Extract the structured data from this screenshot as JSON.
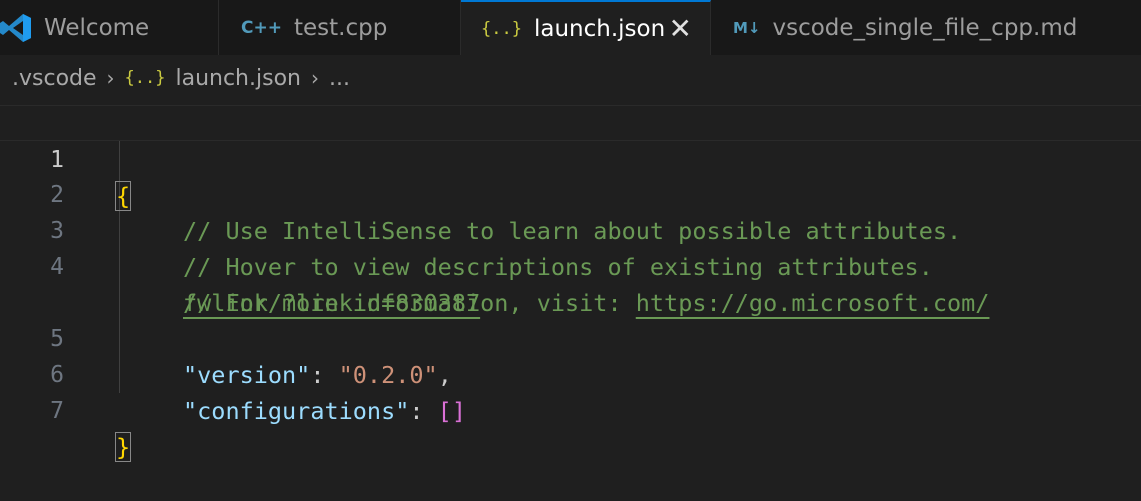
{
  "tabs": [
    {
      "label": "Welcome",
      "icon": "vscode-logo-icon",
      "active": false
    },
    {
      "label": "test.cpp",
      "icon": "cpp-file-icon",
      "icon_text": "C++",
      "active": false
    },
    {
      "label": "launch.json",
      "icon": "json-file-icon",
      "icon_text": "{..}",
      "active": true,
      "close": "✕"
    },
    {
      "label": "vscode_single_file_cpp.md",
      "icon": "markdown-file-icon",
      "icon_text": "M↓",
      "active": false
    }
  ],
  "breadcrumb": {
    "folder": ".vscode",
    "file": "launch.json",
    "file_icon": "{..}",
    "symbol": "...",
    "separator": "›"
  },
  "editor": {
    "line_numbers": [
      "1",
      "2",
      "3",
      "4",
      "5",
      "6",
      "7"
    ],
    "active_line": "1",
    "open_brace": "{",
    "close_brace": "}",
    "comment1": "// Use IntelliSense to learn about possible attributes.",
    "comment2": "// Hover to view descriptions of existing attributes.",
    "comment3_prefix": "// For more information, visit: ",
    "link_part1": "https://go.microsoft.com/",
    "link_part2": "fwlink/?linkid=830387",
    "version_key": "\"version\"",
    "version_value": "\"0.2.0\"",
    "configurations_key": "\"configurations\"",
    "configurations_value": "[]",
    "colon": ": ",
    "comma": ","
  },
  "colors": {
    "accent": "#0078d4",
    "comment": "#6a9955",
    "key": "#9cdcfe",
    "string": "#ce9178",
    "brace": "#ffd700",
    "bracket": "#da70d6"
  }
}
